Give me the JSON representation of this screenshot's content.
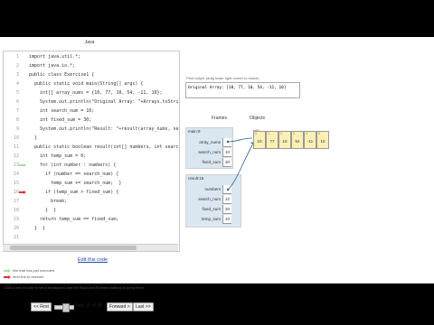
{
  "language": "Java",
  "code_lines": [
    {
      "n": "1",
      "text": "import java.util.*;"
    },
    {
      "n": "2",
      "text": "import java.io.*;"
    },
    {
      "n": "3",
      "text": "public class Exercise1 {"
    },
    {
      "n": "4",
      "text": "  public static void main(String[] args) {"
    },
    {
      "n": "5",
      "text": "    int[] array_nums = {10, 77, 10, 54, -11, 10};"
    },
    {
      "n": "6",
      "text": "    System.out.println(\"Original Array: \"+Arrays.toString(arr"
    },
    {
      "n": "7",
      "text": "    int search_num = 10;"
    },
    {
      "n": "8",
      "text": "    int fixed_sum = 30;"
    },
    {
      "n": "9",
      "text": "    System.out.println(\"Result: \"+result(array_nums, search_n"
    },
    {
      "n": "10",
      "text": "  }"
    },
    {
      "n": "11",
      "text": "  public static boolean result(int[] numbers, int search_num,"
    },
    {
      "n": "12",
      "text": "    int temp_sum = 0;"
    },
    {
      "n": "13",
      "text": "    for (int number : numbers) {"
    },
    {
      "n": "14",
      "text": "      if (number == search_num) {"
    },
    {
      "n": "15",
      "text": "        temp_sum += search_num;  }"
    },
    {
      "n": "16",
      "text": "      if (temp_sum > fixed_sum) {"
    },
    {
      "n": "17",
      "text": "        break;"
    },
    {
      "n": "18",
      "text": "      }  }"
    },
    {
      "n": "19",
      "text": "    return temp_sum == fixed_sum;"
    },
    {
      "n": "20",
      "text": "  }  }"
    },
    {
      "n": "21",
      "text": ""
    }
  ],
  "arrows": {
    "executed_line": "13",
    "next_line": "16"
  },
  "edit_link": "Edit this code",
  "legend": {
    "executed": "line that has just executed",
    "next": "next line to execute"
  },
  "hint": "Click a line of code to set a breakpoint; use the Back and Forward buttons to jump there.",
  "nav": {
    "first": "<< First",
    "back": "< Back",
    "step": "Step 16 of 39",
    "forward": "Forward >",
    "last": "Last >>"
  },
  "printout_label": "Print output (drag lower right corner to resize)",
  "stdout": "Original Array: [10, 77, 10, 54, -11, 10]",
  "frames_header": "Frames",
  "objects_header": "Objects",
  "main_frame": {
    "title": "main:9",
    "vars": [
      {
        "name": "array_nums",
        "value": ""
      },
      {
        "name": "search_num",
        "value": "10"
      },
      {
        "name": "fixed_sum",
        "value": "30"
      }
    ]
  },
  "result_frame": {
    "title": "result:16",
    "vars": [
      {
        "name": "numbers",
        "value": ""
      },
      {
        "name": "search_num",
        "value": "10"
      },
      {
        "name": "fixed_sum",
        "value": "30"
      },
      {
        "name": "temp_sum",
        "value": "10"
      }
    ]
  },
  "array": {
    "label": "int[]",
    "cells": [
      {
        "idx": "0",
        "val": "10"
      },
      {
        "idx": "1",
        "val": "77"
      },
      {
        "idx": "2",
        "val": "10"
      },
      {
        "idx": "3",
        "val": "54"
      },
      {
        "idx": "4",
        "val": "-11"
      },
      {
        "idx": "5",
        "val": "10"
      }
    ]
  },
  "colors": {
    "executed_arrow": "#aaddaa",
    "next_arrow": "#dd3333",
    "frame_bg": "#dae6f0",
    "array_cell": "#faf0b4"
  }
}
